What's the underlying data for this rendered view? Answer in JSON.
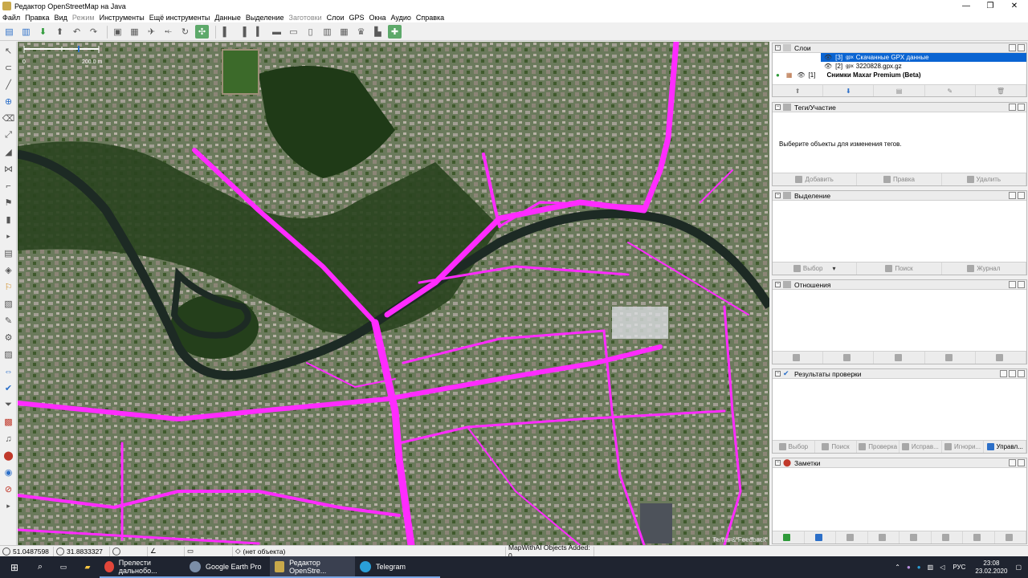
{
  "window": {
    "title": "Редактор OpenStreetMap на Java"
  },
  "menu": [
    "Файл",
    "Правка",
    "Вид",
    "Режим",
    "Инструменты",
    "Ещё инструменты",
    "Данные",
    "Выделение",
    "Заготовки",
    "Слои",
    "GPS",
    "Окна",
    "Аудио",
    "Справка"
  ],
  "menu_dim": [
    false,
    false,
    false,
    true,
    false,
    false,
    false,
    false,
    true,
    false,
    false,
    false,
    false,
    false
  ],
  "map": {
    "scale_zero": "0",
    "scale_label": "200.0 m",
    "attribution": "Terms & Feedback"
  },
  "layers": {
    "title": "Слои",
    "items": [
      {
        "index": "[3]",
        "name": "Скачанные GPX данные",
        "selected": true
      },
      {
        "index": "[2]",
        "name": "3220828.gpx.gz",
        "selected": false
      },
      {
        "index": "[1]",
        "name": "Снимки Maxar Premium (Beta)",
        "selected": false
      }
    ]
  },
  "tags": {
    "title": "Теги/Участие",
    "hint": "Выберите объекты для изменения тегов.",
    "add": "Добавить",
    "edit": "Правка",
    "delete": "Удалить"
  },
  "selection": {
    "title": "Выделение",
    "select": "Выбор",
    "search": "Поиск",
    "history": "Журнал"
  },
  "relations": {
    "title": "Отношения"
  },
  "validation": {
    "title": "Результаты проверки",
    "select": "Выбор",
    "search": "Поиск",
    "check": "Проверка",
    "fix": "Исправ...",
    "ignore": "Игнори...",
    "manage": "Управл..."
  },
  "notes": {
    "title": "Заметки"
  },
  "status": {
    "lat": "51.0487598",
    "lon": "31.8833327",
    "object": "(нет объекта)",
    "mapwithai": "MapWithAI Objects Added: 0"
  },
  "taskbar": {
    "apps": [
      "Прелести дальнобо...",
      "Google Earth Pro",
      "Редактор OpenStre...",
      "Telegram"
    ],
    "lang": "РУС",
    "time": "23:08",
    "date": "23.02.2020"
  },
  "colors": {
    "gpx_track": "#ff2bff",
    "selection": "#0a64d2",
    "taskbar": "#1f2430"
  }
}
